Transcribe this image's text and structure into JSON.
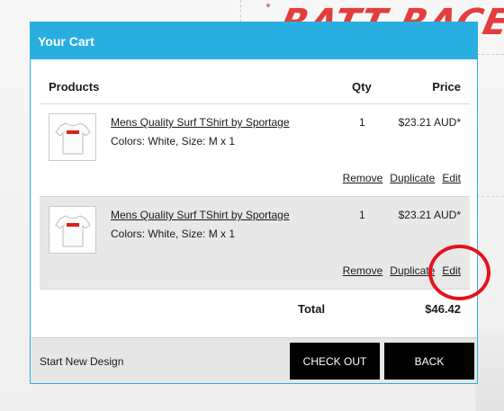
{
  "background": {
    "logo_text": "RATT RACER"
  },
  "cart": {
    "title": "Your Cart",
    "columns": {
      "products": "Products",
      "qty": "Qty",
      "price": "Price"
    },
    "items": [
      {
        "name": "Mens Quality Surf TShirt by Sportage",
        "attributes": "Colors: White, Size: M x 1",
        "qty": "1",
        "price": "$23.21 AUD*",
        "thumb_icon": "white-tshirt-icon",
        "actions": {
          "remove": "Remove",
          "duplicate": "Duplicate",
          "edit": "Edit"
        }
      },
      {
        "name": "Mens Quality Surf TShirt by Sportage",
        "attributes": "Colors: White, Size: M x 1",
        "qty": "1",
        "price": "$23.21 AUD*",
        "thumb_icon": "white-tshirt-icon",
        "actions": {
          "remove": "Remove",
          "duplicate": "Duplicate",
          "edit": "Edit"
        }
      }
    ],
    "total_label": "Total",
    "total_value": "$46.42"
  },
  "footer": {
    "start_new_design": "Start New Design",
    "checkout_label": "CHECK OUT",
    "back_label": "BACK"
  },
  "colors": {
    "header_blue": "#29aee0",
    "button_black": "#000000",
    "annotation_red": "#e3141a",
    "logo_red": "#e02a2a"
  }
}
